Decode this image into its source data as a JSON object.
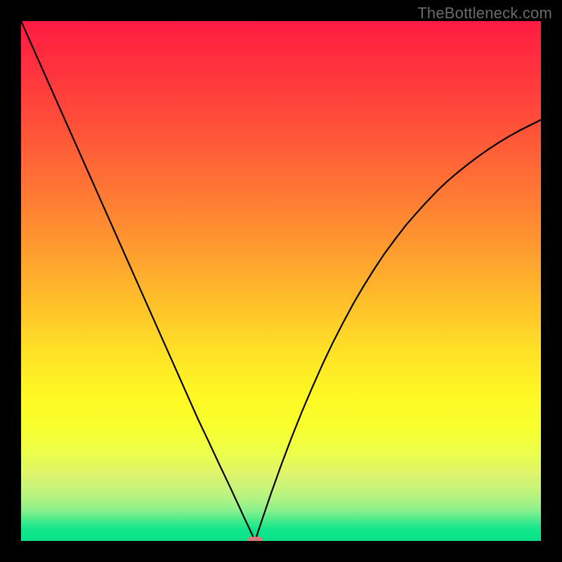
{
  "watermark": "TheBottleneck.com",
  "colors": {
    "frame": "#000000",
    "curve_stroke": "#000000",
    "marker_fill": "#d97a7a",
    "watermark_text": "#6b6b6b"
  },
  "chart_data": {
    "type": "line",
    "title": "",
    "xlabel": "",
    "ylabel": "",
    "xlim": [
      0,
      100
    ],
    "ylim": [
      0,
      100
    ],
    "x": [
      0,
      2,
      4,
      6,
      8,
      10,
      12,
      14,
      16,
      18,
      20,
      22,
      24,
      26,
      28,
      30,
      32,
      34,
      36,
      38,
      40,
      42,
      43,
      44,
      45,
      46,
      48,
      50,
      52,
      54,
      56,
      58,
      60,
      62,
      64,
      66,
      68,
      70,
      72,
      74,
      76,
      78,
      80,
      82,
      84,
      86,
      88,
      90,
      92,
      94,
      96,
      98,
      100
    ],
    "values": [
      100.0,
      95.5,
      91.0,
      86.5,
      82.0,
      77.5,
      73.0,
      68.5,
      64.0,
      59.5,
      55.0,
      50.5,
      46.0,
      41.5,
      37.0,
      32.5,
      28.0,
      23.5,
      19.3,
      15.0,
      10.8,
      6.5,
      4.3,
      2.2,
      0.0,
      3.0,
      8.9,
      14.5,
      19.8,
      24.8,
      29.5,
      34.0,
      38.2,
      42.1,
      45.8,
      49.2,
      52.4,
      55.4,
      58.1,
      60.7,
      63.0,
      65.2,
      67.3,
      69.2,
      70.9,
      72.5,
      74.0,
      75.4,
      76.7,
      77.9,
      79.0,
      80.0,
      81.0
    ],
    "marker": {
      "x": 45,
      "y": 0
    },
    "gradient_stops": [
      {
        "pos": 0.0,
        "color": "#ff1a44"
      },
      {
        "pos": 0.18,
        "color": "#ff4a3a"
      },
      {
        "pos": 0.42,
        "color": "#ff9530"
      },
      {
        "pos": 0.64,
        "color": "#ffe326"
      },
      {
        "pos": 0.83,
        "color": "#ecff4a"
      },
      {
        "pos": 0.965,
        "color": "#37e98b"
      },
      {
        "pos": 1.0,
        "color": "#08e289"
      }
    ]
  }
}
